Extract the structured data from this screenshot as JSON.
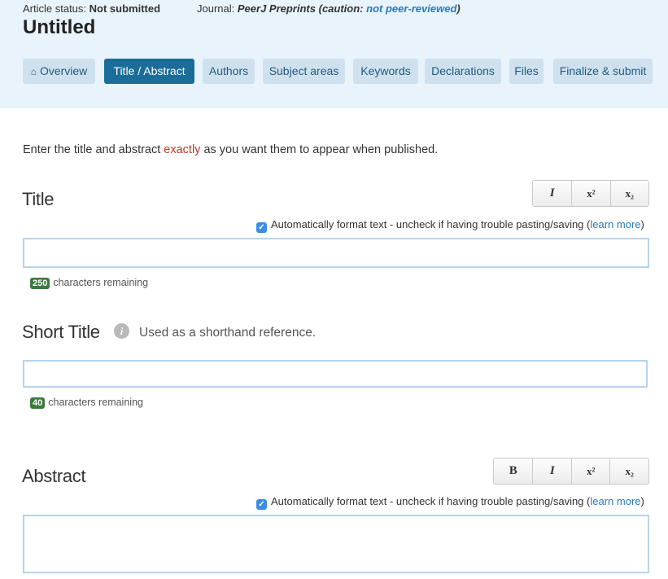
{
  "header": {
    "status_label": "Article status:",
    "status_value": "Not submitted",
    "journal_label": "Journal:",
    "journal_name": "PeerJ Preprints",
    "caution_prefix": "(caution:",
    "caution_link": "not peer-reviewed",
    "caution_suffix": ")",
    "title": "Untitled"
  },
  "tabs": [
    {
      "label": "Overview",
      "icon": "home-icon"
    },
    {
      "label": "Title / Abstract",
      "active": true
    },
    {
      "label": "Authors"
    },
    {
      "label": "Subject areas"
    },
    {
      "label": "Keywords"
    },
    {
      "label": "Declarations"
    },
    {
      "label": "Files"
    },
    {
      "label": "Finalize & submit"
    }
  ],
  "intro": {
    "before": "Enter the title and abstract",
    "highlight": "exactly",
    "after": "as you want them to appear when published."
  },
  "title_section": {
    "heading": "Title",
    "format_buttons": [
      "I",
      "x²",
      "x₂"
    ],
    "autoformat_text": "Automatically format text - uncheck if having trouble pasting/saving (",
    "autoformat_link": "learn more",
    "autoformat_close": ")",
    "input_value": "",
    "chars_remaining": "250",
    "chars_label": "characters remaining"
  },
  "short_title_section": {
    "heading": "Short Title",
    "info_icon": "info-icon",
    "hint": "Used as a shorthand reference.",
    "input_value": "",
    "chars_remaining": "40",
    "chars_label": "characters remaining"
  },
  "abstract_section": {
    "heading": "Abstract",
    "format_buttons": [
      "B",
      "I",
      "x²",
      "x₂"
    ],
    "autoformat_text": "Automatically format text - uncheck if having trouble pasting/saving (",
    "autoformat_link": "learn more",
    "autoformat_close": ")",
    "input_value": ""
  },
  "colors": {
    "header_bg": "#e8f3fb",
    "tab_bg": "#cfe1ee",
    "tab_active_bg": "#1a6d99",
    "counter_badge": "#3c7a3c",
    "highlight": "#c0392b",
    "link": "#2a7ab8"
  }
}
